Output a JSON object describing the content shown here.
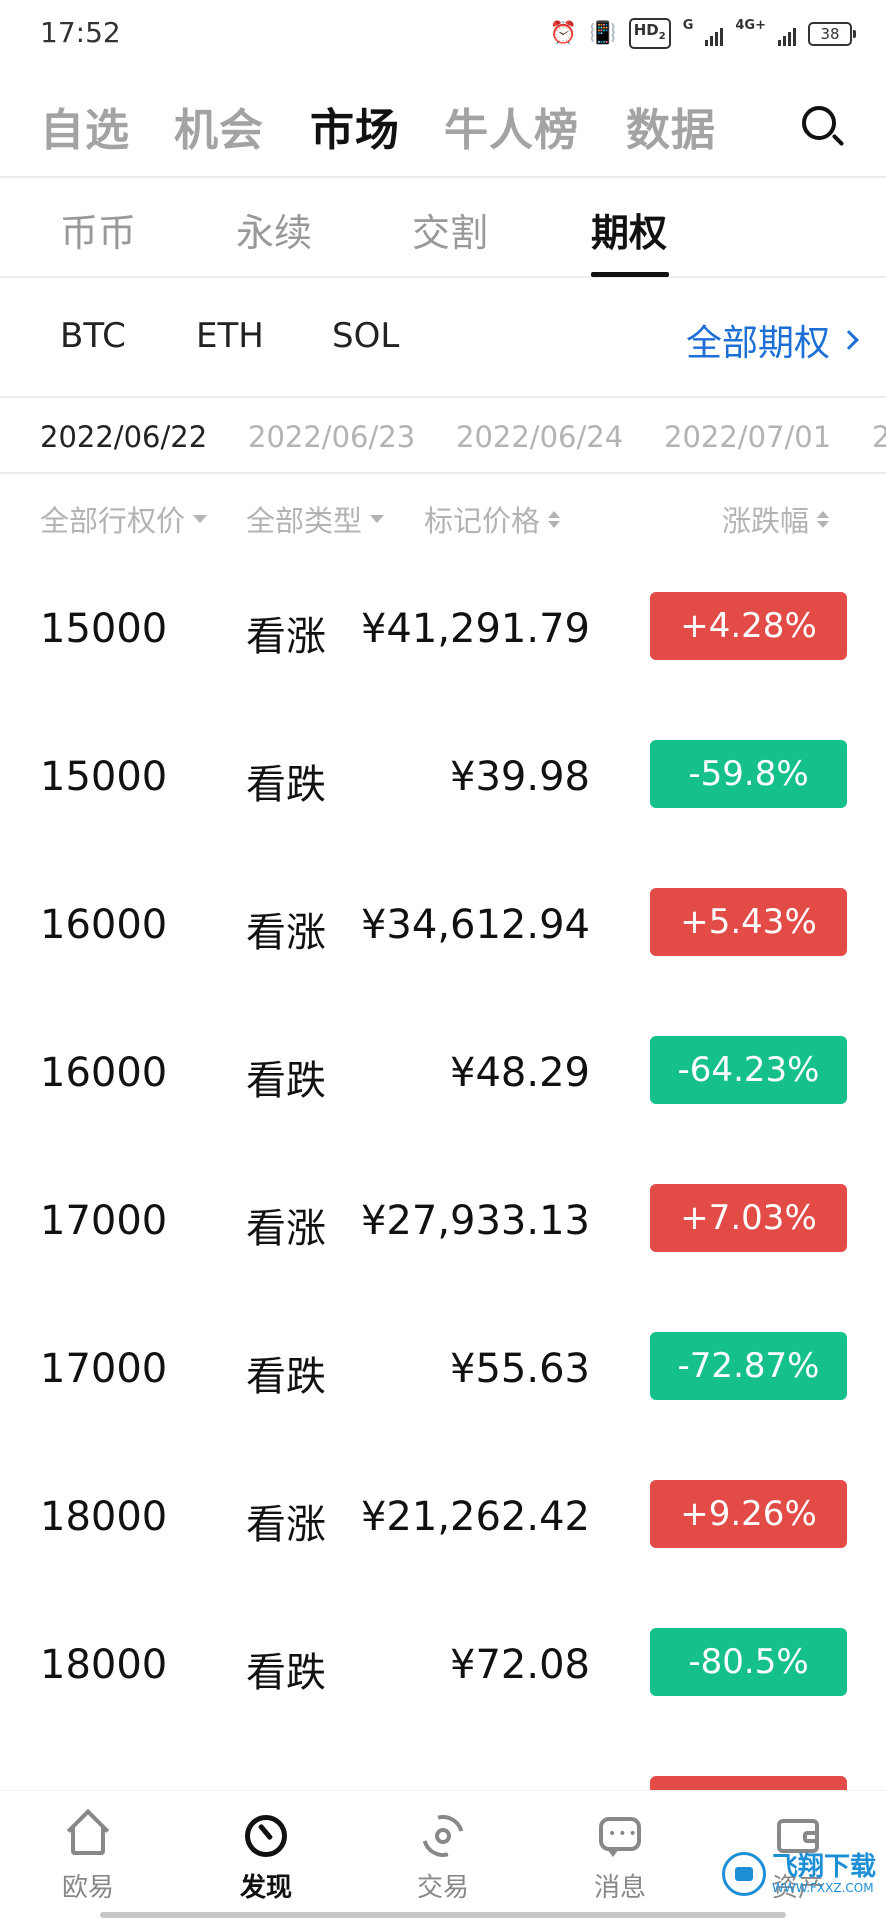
{
  "status_bar": {
    "time": "17:52",
    "hd_label": "HD",
    "hd_sub": "2",
    "g_label": "G",
    "net_label": "4G+",
    "battery": "38"
  },
  "top_nav": {
    "tabs": [
      {
        "label": "自选",
        "active": false
      },
      {
        "label": "机会",
        "active": false
      },
      {
        "label": "市场",
        "active": true
      },
      {
        "label": "牛人榜",
        "active": false
      },
      {
        "label": "数据",
        "active": false
      }
    ],
    "search_icon": "search-icon"
  },
  "sub_nav": {
    "tabs": [
      {
        "label": "币币",
        "active": false
      },
      {
        "label": "永续",
        "active": false
      },
      {
        "label": "交割",
        "active": false
      },
      {
        "label": "期权",
        "active": true
      }
    ]
  },
  "coin_filter": {
    "coins": [
      "BTC",
      "ETH",
      "SOL"
    ],
    "all_options_label": "全部期权"
  },
  "dates": [
    {
      "label": "2022/06/22",
      "active": true
    },
    {
      "label": "2022/06/23",
      "active": false
    },
    {
      "label": "2022/06/24",
      "active": false
    },
    {
      "label": "2022/07/01",
      "active": false
    },
    {
      "label": "2",
      "active": false
    }
  ],
  "columns": {
    "strike": "全部行权价",
    "type": "全部类型",
    "mark_price": "标记价格",
    "change": "涨跌幅"
  },
  "colors": {
    "up": "#e34b47",
    "down": "#16c08a",
    "accent": "#1d6fd6"
  },
  "rows": [
    {
      "strike": "15000",
      "type": "看涨",
      "price": "¥41,291.79",
      "change": "+4.28%",
      "direction": "up"
    },
    {
      "strike": "15000",
      "type": "看跌",
      "price": "¥39.98",
      "change": "-59.8%",
      "direction": "down"
    },
    {
      "strike": "16000",
      "type": "看涨",
      "price": "¥34,612.94",
      "change": "+5.43%",
      "direction": "up"
    },
    {
      "strike": "16000",
      "type": "看跌",
      "price": "¥48.29",
      "change": "-64.23%",
      "direction": "down"
    },
    {
      "strike": "17000",
      "type": "看涨",
      "price": "¥27,933.13",
      "change": "+7.03%",
      "direction": "up"
    },
    {
      "strike": "17000",
      "type": "看跌",
      "price": "¥55.63",
      "change": "-72.87%",
      "direction": "down"
    },
    {
      "strike": "18000",
      "type": "看涨",
      "price": "¥21,262.42",
      "change": "+9.26%",
      "direction": "up"
    },
    {
      "strike": "18000",
      "type": "看跌",
      "price": "¥72.08",
      "change": "-80.5%",
      "direction": "down"
    },
    {
      "strike": "",
      "type": "",
      "price": "",
      "change": "",
      "direction": "up"
    }
  ],
  "bottom_nav": [
    {
      "label": "欧易",
      "icon": "home-icon",
      "active": false
    },
    {
      "label": "发现",
      "icon": "discover-icon",
      "active": true
    },
    {
      "label": "交易",
      "icon": "trade-icon",
      "active": false
    },
    {
      "label": "消息",
      "icon": "message-icon",
      "active": false
    },
    {
      "label": "资产",
      "icon": "wallet-icon",
      "active": false
    }
  ],
  "watermark": {
    "main": "飞翔下载",
    "sub": "WWW.FXXZ.COM"
  }
}
